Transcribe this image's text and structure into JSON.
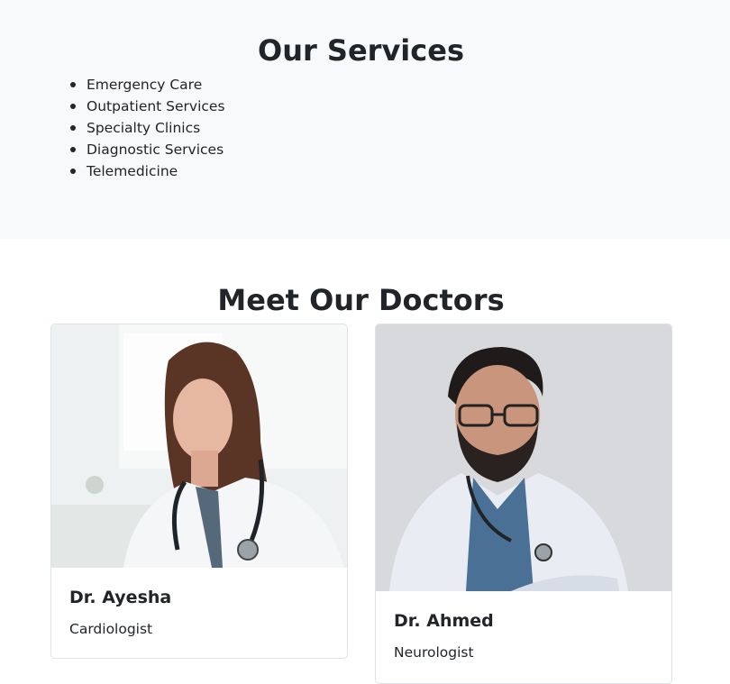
{
  "services": {
    "title": "Our Services",
    "items": [
      "Emergency Care",
      "Outpatient Services",
      "Specialty Clinics",
      "Diagnostic Services",
      "Telemedicine"
    ]
  },
  "doctors": {
    "title": "Meet Our Doctors",
    "cards": [
      {
        "name": "Dr. Ayesha",
        "specialty": "Cardiologist"
      },
      {
        "name": "Dr. Ahmed",
        "specialty": "Neurologist"
      }
    ]
  },
  "colors": {
    "section_bg": "#f8f9fa",
    "text": "#212529",
    "card_border": "#dfe2e6"
  }
}
